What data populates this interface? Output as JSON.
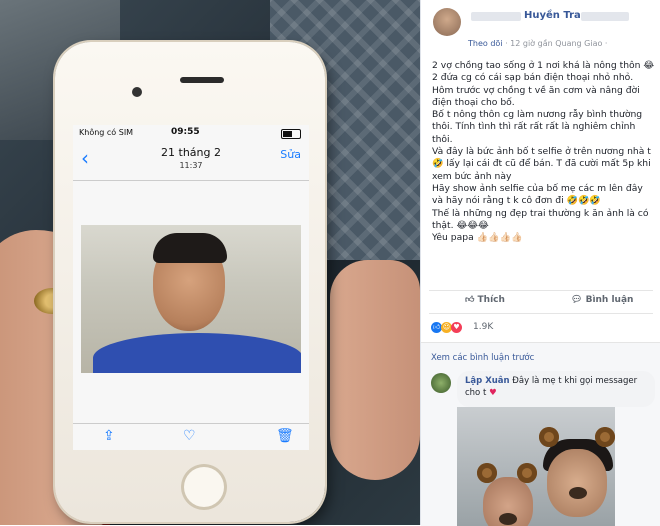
{
  "phone": {
    "carrier": "Không có SIM",
    "time": "09:55",
    "nav_date": "21 tháng 2",
    "nav_time": "11:37",
    "edit_label": "Sửa",
    "icons": [
      "chevron-left-icon",
      "share-icon",
      "heart-icon",
      "trash-icon"
    ],
    "accent_color": "#1a7cff"
  },
  "post": {
    "author": "Huyền Trang",
    "follow_label": "Theo dõi",
    "time_location": "· 12 giờ gần Quang Giao ·",
    "paragraphs": [
      "2 vợ chồng tao sống ở 1 nơi khá là nông thôn 😂 2 đứa cg có cái sạp bán điện thoại nhỏ nhỏ.",
      "Hôm trước vợ chồng t về ăn cơm và nâng đời điện thoại cho bố.",
      "Bố t nông thôn cg làm nương rẫy bình thường thôi. Tính tình thì rất rất rất là nghiêm chỉnh thôi.",
      "Và đây là bức ảnh bố t selfie ở trên nương nhà t 🤣 lấy lại cái đt cũ để bán. T đã cười mất 5p khi xem bức ảnh này",
      "Hãy show ảnh selfie của bố mẹ các m lên đây và hãy nói rằng t k cô đơn đi 🤣🤣🤣",
      "Thế là những ng đẹp trai thường k ăn ảnh là có thật. 😂😂😂",
      "Yêu papa 👍🏻👍🏻👍🏻👍🏻"
    ],
    "like_label": "Thích",
    "comment_label": "Bình luận",
    "reaction_count": "1.9K",
    "brand_color": "#385898"
  },
  "comments": {
    "view_previous": "Xem các bình luận trước",
    "items": [
      {
        "name": "Lập Xuân",
        "text": "Đây là mẹ t khi gọi messager cho t",
        "emoji": "♥"
      }
    ]
  }
}
